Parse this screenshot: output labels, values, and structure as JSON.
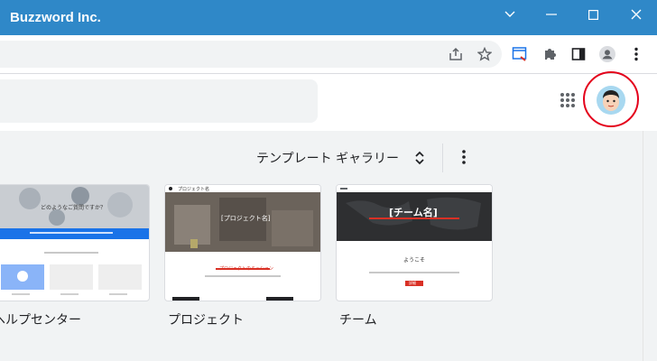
{
  "window": {
    "title": "Buzzword Inc.",
    "title_color": "#2f88c8"
  },
  "toolbar": {
    "icons": [
      "share-icon",
      "star-icon",
      "extension-screenshot-icon",
      "puzzle-icon",
      "side-panel-icon",
      "profile-icon",
      "kebab-menu-icon"
    ]
  },
  "appbar": {
    "icons": [
      "apps-grid-icon",
      "account-avatar-icon"
    ],
    "highlight_color": "#e4001b"
  },
  "gallery": {
    "label": "テンプレート ギャラリー",
    "templates": [
      {
        "title": "ヘルプセンター",
        "hero_text": "どのようなご質問ですか？"
      },
      {
        "title": "プロジェクト",
        "header_text": "プロジェクト名",
        "hero_text": "[プロジェクト名]",
        "section_title": "プロジェクトのミッション"
      },
      {
        "title": "チーム",
        "hero_text": "[チーム名]",
        "welcome_text": "ようこそ",
        "button_text": "詳細"
      }
    ]
  }
}
